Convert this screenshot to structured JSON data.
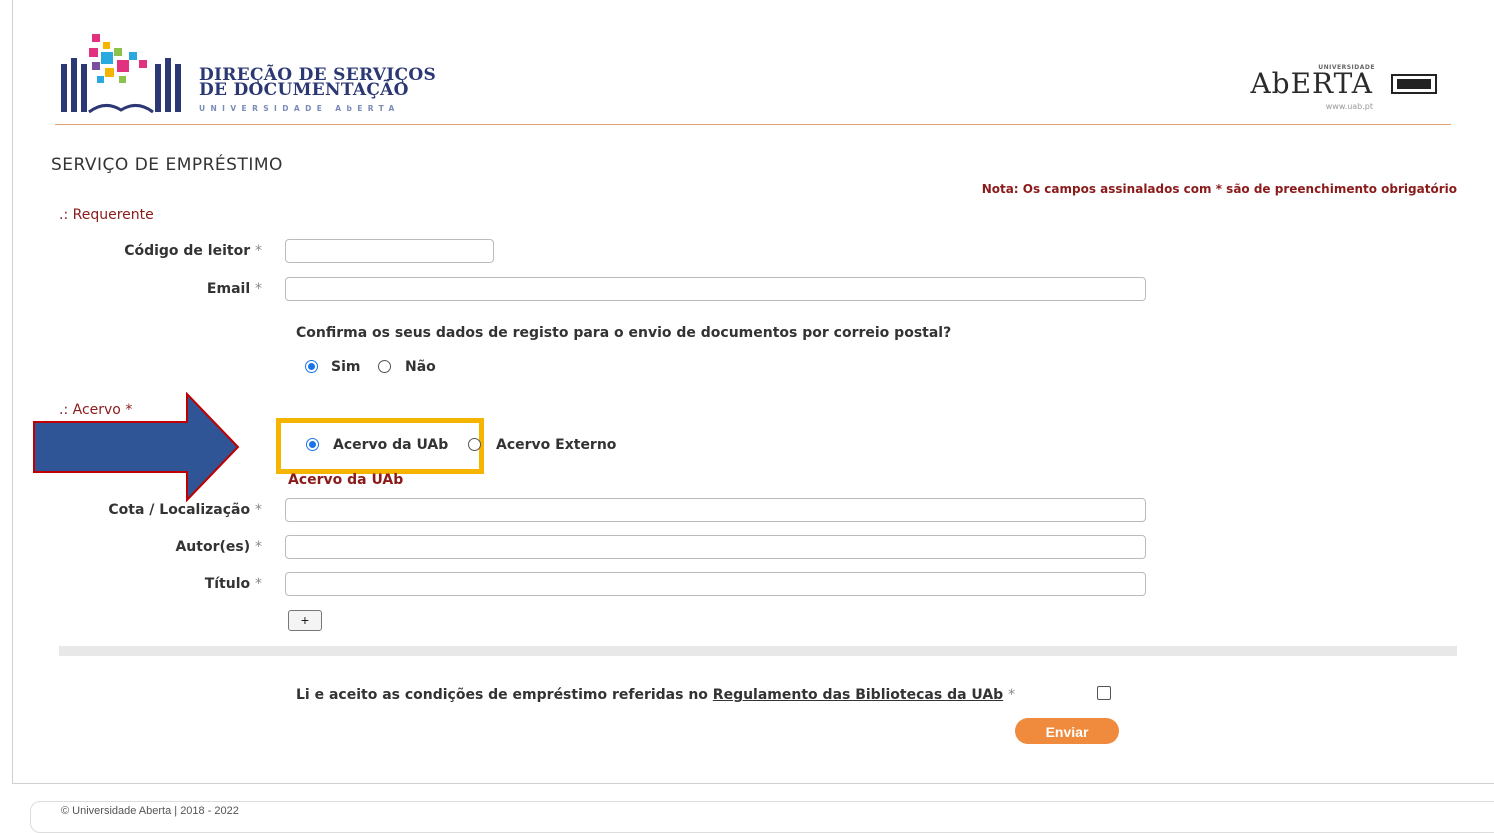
{
  "header": {
    "logo_title_line1": "DIREÇÃO DE SERVIÇOS",
    "logo_title_line2": "DE DOCUMENTAÇÃO",
    "logo_subtitle": "UNIVERSIDADE AbERTA",
    "uab_small": "UNIVERSIDADE",
    "uab_big": "AbERTA",
    "uab_www": "www.uab.pt"
  },
  "page": {
    "title": "SERVIÇO DE EMPRÉSTIMO",
    "nota": "Nota: Os campos assinalados com * são de preenchimento obrigatório"
  },
  "requerente": {
    "section": ".: Requerente",
    "codigo_label": "Código de leitor",
    "email_label": "Email",
    "required_mark": "*",
    "confirm_question": "Confirma os seus dados de registo para o envio de documentos por correio postal?",
    "opt_sim": "Sim",
    "opt_nao": "Não",
    "selected": "Sim"
  },
  "acervo": {
    "section": ".: Acervo *",
    "opt_uab": "Acervo da UAb",
    "opt_externo": "Acervo Externo",
    "selected": "Acervo da UAb",
    "sub_heading": "Acervo da UAb",
    "cota_label": "Cota / Localização",
    "autor_label": "Autor(es)",
    "titulo_label": "Título",
    "plus": "+"
  },
  "agreement": {
    "text": "Li e aceito as condições de empréstimo referidas no",
    "link": "Regulamento das Bibliotecas da UAb",
    "required_mark": "*",
    "checked": false
  },
  "actions": {
    "send": "Enviar"
  },
  "footer": {
    "text": "© Universidade Aberta | 2018 - 2022"
  },
  "colors": {
    "accent": "#f08a3c",
    "section_red": "#8b1a1a",
    "highlight": "#f4b400",
    "arrow": "#2f5597",
    "arrow_border": "#c00000"
  }
}
